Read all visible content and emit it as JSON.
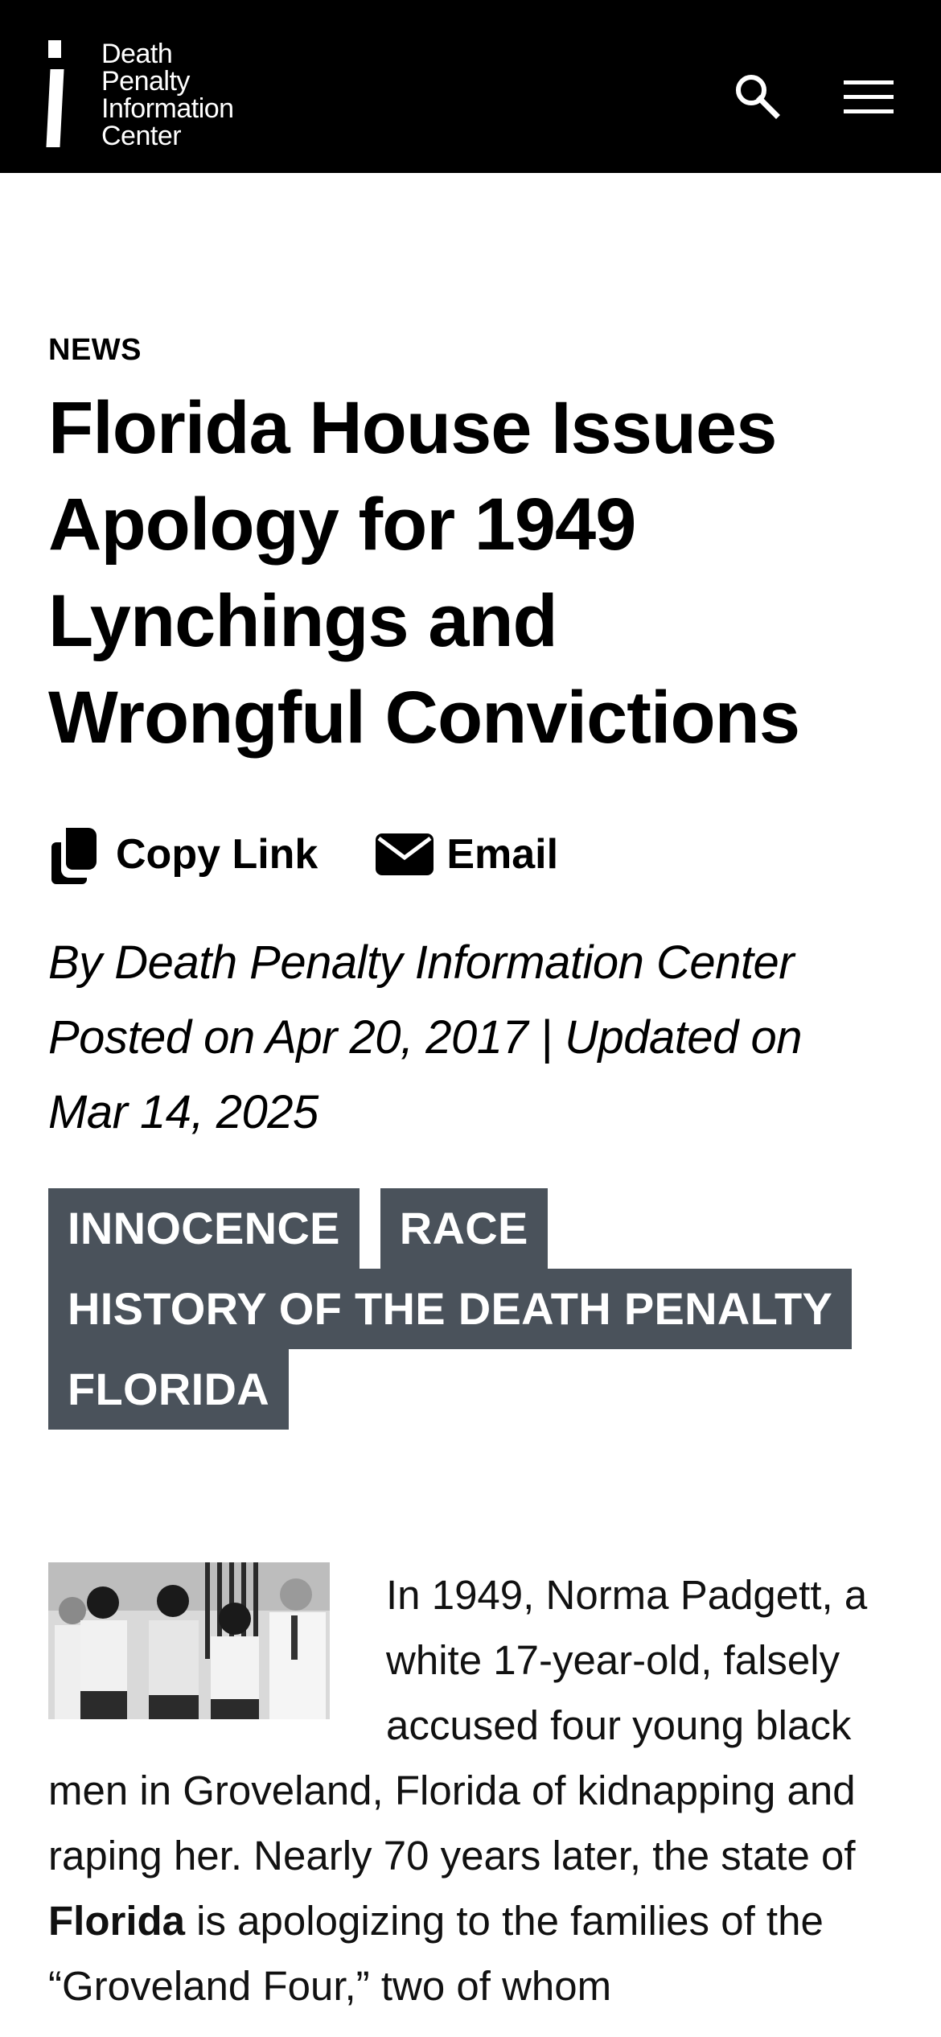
{
  "header": {
    "logo_lines": [
      "Death",
      "Penalty",
      "Information",
      "Center"
    ],
    "search_icon": "search-icon",
    "menu_icon": "hamburger-menu-icon"
  },
  "article": {
    "eyebrow": "NEWS",
    "title": "Florida House Issues Apology for 1949 Lynchings and Wrongful Convictions",
    "share": {
      "copy_label": "Copy Link",
      "copy_icon": "copy-icon",
      "email_label": "Email",
      "email_icon": "envelope-icon"
    },
    "byline_author": "By Death Penalty Information Center",
    "byline_dates": "Posted on Apr 20, 2017 | Updated on Mar 14, 2025",
    "tags": [
      "INNOCENCE",
      "RACE",
      "HISTORY OF THE DEATH PENALTY",
      "FLORIDA"
    ],
    "body": {
      "intro": "In 1949, Norma Padgett, a white 17-year-old, falsely accused four young black men in Groveland, Florida of kidnapping and raping her. Nearly 70 years later, the state of ",
      "bold": "Florida",
      "rest": " is apologizing to the families of the “Groveland Four,” two of whom"
    }
  },
  "colors": {
    "header_bg": "#000000",
    "tag_bg": "#4a525b",
    "tag_text": "#ffffff"
  }
}
